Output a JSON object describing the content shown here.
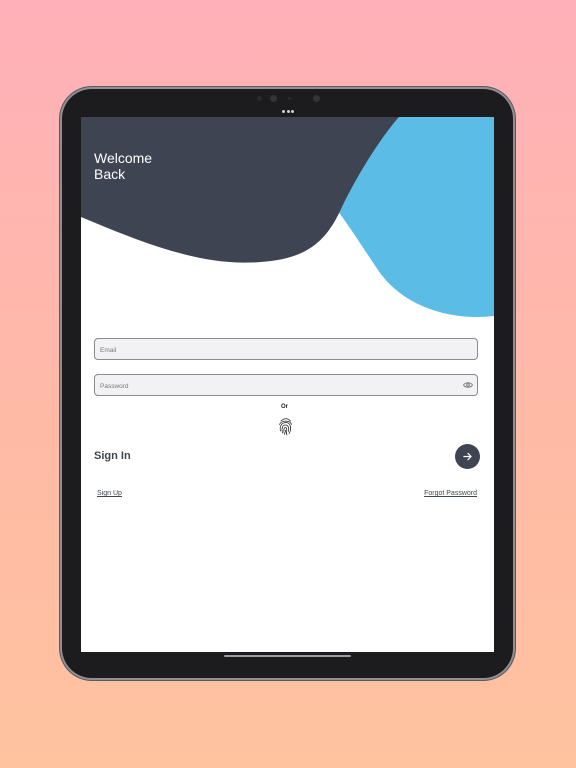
{
  "header": {
    "welcome_line1": "Welcome",
    "welcome_line2": "Back"
  },
  "form": {
    "email_placeholder": "Email",
    "email_value": "",
    "password_placeholder": "Password",
    "password_value": "",
    "or_label": "Or",
    "signin_label": "Sign In"
  },
  "links": {
    "signup": "Sign Up",
    "forgot_password": "Forgot Password"
  },
  "icons": {
    "eye": "eye-icon",
    "fingerprint": "fingerprint-icon",
    "arrow": "arrow-right-icon"
  },
  "colors": {
    "dark_blob": "#3e4451",
    "blue_blob": "#5bbde6",
    "button": "#3e4451",
    "text": "#3f4650"
  }
}
